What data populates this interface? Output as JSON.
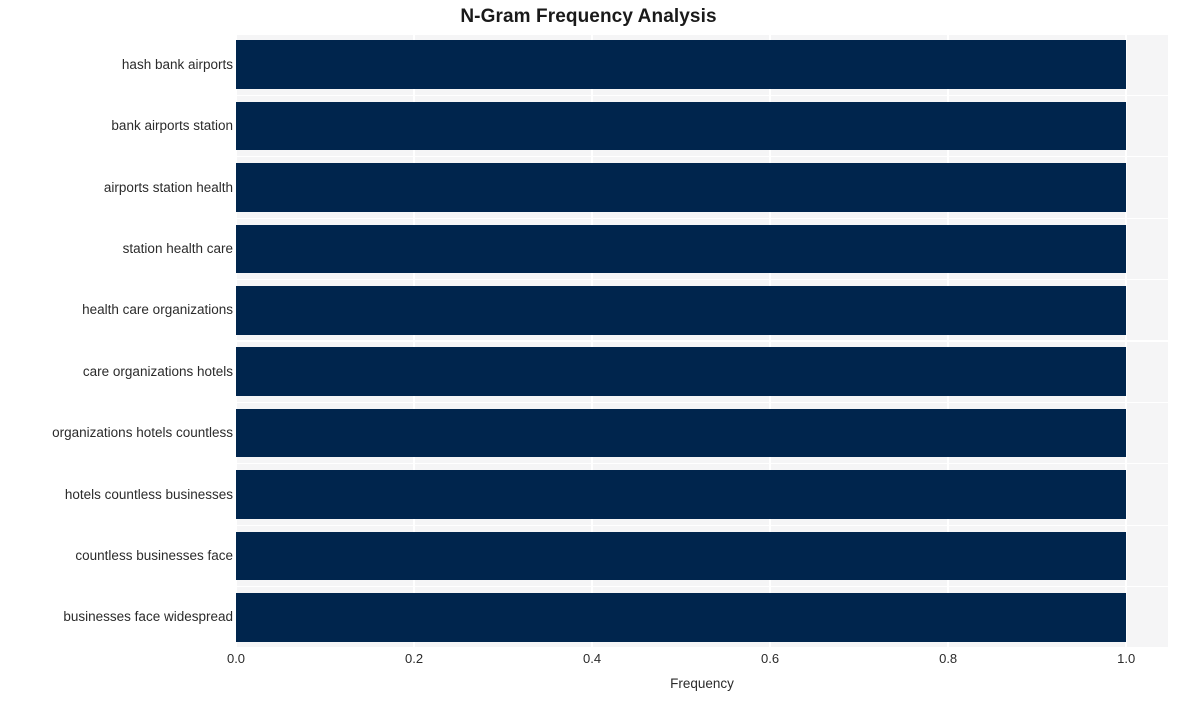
{
  "chart_data": {
    "type": "bar",
    "orientation": "horizontal",
    "title": "N-Gram Frequency Analysis",
    "xlabel": "Frequency",
    "ylabel": "",
    "categories": [
      "hash bank airports",
      "bank airports station",
      "airports station health",
      "station health care",
      "health care organizations",
      "care organizations hotels",
      "organizations hotels countless",
      "hotels countless businesses",
      "countless businesses face",
      "businesses face widespread"
    ],
    "values": [
      1.0,
      1.0,
      1.0,
      1.0,
      1.0,
      1.0,
      1.0,
      1.0,
      1.0,
      1.0
    ],
    "xlim": [
      0.0,
      1.047
    ],
    "xticks": [
      0.0,
      0.2,
      0.4,
      0.6,
      0.8,
      1.0
    ],
    "xtick_labels": [
      "0.0",
      "0.2",
      "0.4",
      "0.6",
      "0.8",
      "1.0"
    ],
    "grid": true,
    "grid_color": "#ffffff",
    "legend": null,
    "bar_color": "#00254d",
    "plot_background": "#f5f5f6",
    "figure_background": "#ffffff",
    "text_color": "#2b2b2b"
  }
}
